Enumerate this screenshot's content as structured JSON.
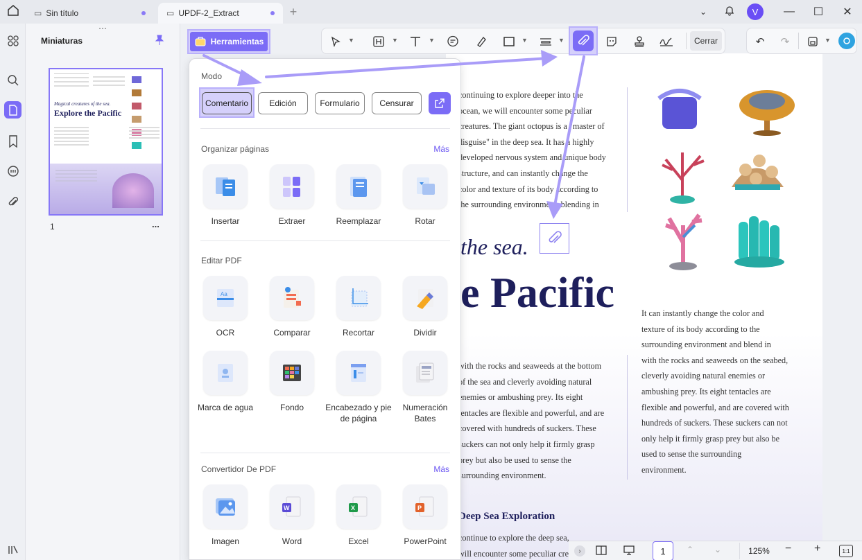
{
  "titlebar": {
    "tab1_label": "Sin título",
    "tab2_label": "UPDF-2_Extract",
    "avatar_letter": "V"
  },
  "thumbnails": {
    "title": "Miniaturas",
    "page_number": "1",
    "more": "...",
    "mini_heading": "Explore the Pacific",
    "mini_subheading": "Magical creatures of the sea."
  },
  "toolbar": {
    "herramientas_label": "Herramientas",
    "cerrar_label": "Cerrar"
  },
  "panel": {
    "modo_title": "Modo",
    "modes": [
      "Comentario",
      "Edición",
      "Formulario",
      "Censurar"
    ],
    "organizar_title": "Organizar páginas",
    "organizar_more": "Más",
    "organizar_tools": [
      "Insertar",
      "Extraer",
      "Reemplazar",
      "Rotar"
    ],
    "editar_title": "Editar PDF",
    "editar_tools_row1": [
      "OCR",
      "Comparar",
      "Recortar",
      "Dividir"
    ],
    "editar_tools_row2": [
      "Marca de agua",
      "Fondo",
      "Encabezado y pie de página",
      "Numeración Bates"
    ],
    "convertidor_title": "Convertidor De PDF",
    "convertidor_more": "Más",
    "convertidor_tools": [
      "Imagen",
      "Word",
      "Excel",
      "PowerPoint"
    ]
  },
  "document": {
    "para1": [
      "continuing to explore deeper into the",
      "ocean, we will encounter some peculiar",
      "creatures. The giant octopus is a \"master of",
      "disguise\" in the deep sea. It has a highly",
      "developed nervous system and unique body",
      "structure, and can instantly change the",
      "color and texture of its body according to",
      "the surrounding environment, blending in"
    ],
    "subtitle": "the sea.",
    "heading": "e Pacific",
    "para2": [
      "with the rocks and seaweeds at the bottom",
      "of the sea and cleverly avoiding natural",
      "enemies or ambushing prey. Its eight",
      "tentacles are flexible and powerful, and are",
      "covered with hundreds of suckers. These",
      "suckers can not only help it firmly grasp",
      "prey but also be used to sense the",
      "surrounding environment."
    ],
    "para3": [
      "It can instantly change the color and",
      "texture of its body according to the",
      "surrounding environment and blend in",
      "with the rocks and seaweeds on the seabed,",
      "cleverly avoiding natural enemies or",
      "ambushing prey. Its eight tentacles are",
      "flexible and powerful, and are covered with",
      "hundreds of suckers. These suckers can not",
      "only help it firmly grasp prey but also be",
      "used to sense the surrounding",
      "environment."
    ],
    "section_heading": "Deep Sea Exploration",
    "para4": [
      "continue to explore the deep sea,",
      "will encounter some peculiar cre"
    ]
  },
  "bottombar": {
    "page": "1",
    "zoom": "125%",
    "fit": "1:1"
  },
  "colors": {
    "accent": "#7b6cf6",
    "highlight": "#b9b0fb",
    "heading": "#1e1f5c"
  }
}
